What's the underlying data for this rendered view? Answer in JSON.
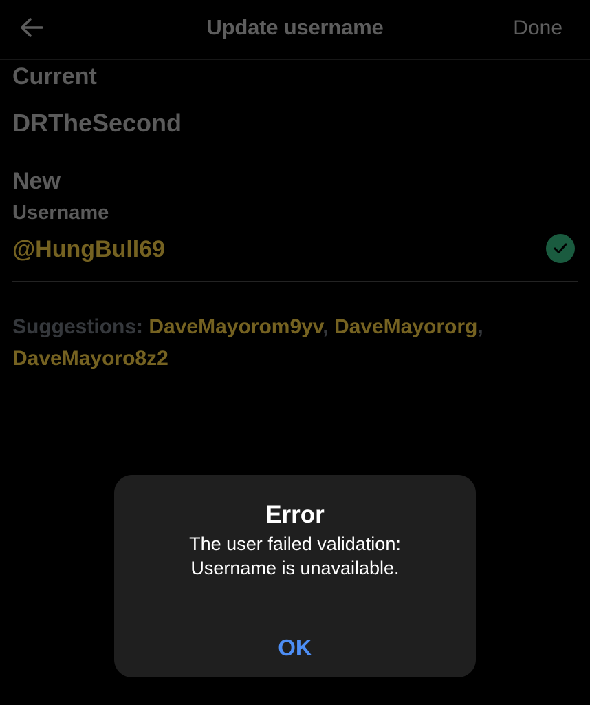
{
  "header": {
    "title": "Update username",
    "done_label": "Done",
    "back_icon": "arrow-left-icon"
  },
  "form": {
    "current_label": "Current",
    "current_value": "DRTheSecond",
    "new_label": "New",
    "username_label": "Username",
    "username_value": "@HungBull69",
    "valid_icon": "checkmark-circle-icon"
  },
  "suggestions": {
    "label": "Suggestions:",
    "items": [
      "DaveMayorom9yv",
      "DaveMayororg",
      "DaveMayoro8z2"
    ],
    "separator": ","
  },
  "alert": {
    "title": "Error",
    "message_line1": "The user failed validation:",
    "message_line2": "Username is unavailable.",
    "ok_label": "OK"
  },
  "colors": {
    "background": "#000000",
    "muted_text": "#6c6c6c",
    "accent_gold": "#8a7427",
    "valid_green": "#1f6b4b",
    "alert_bg": "#1f1f1f",
    "alert_button": "#4d8ef5"
  }
}
